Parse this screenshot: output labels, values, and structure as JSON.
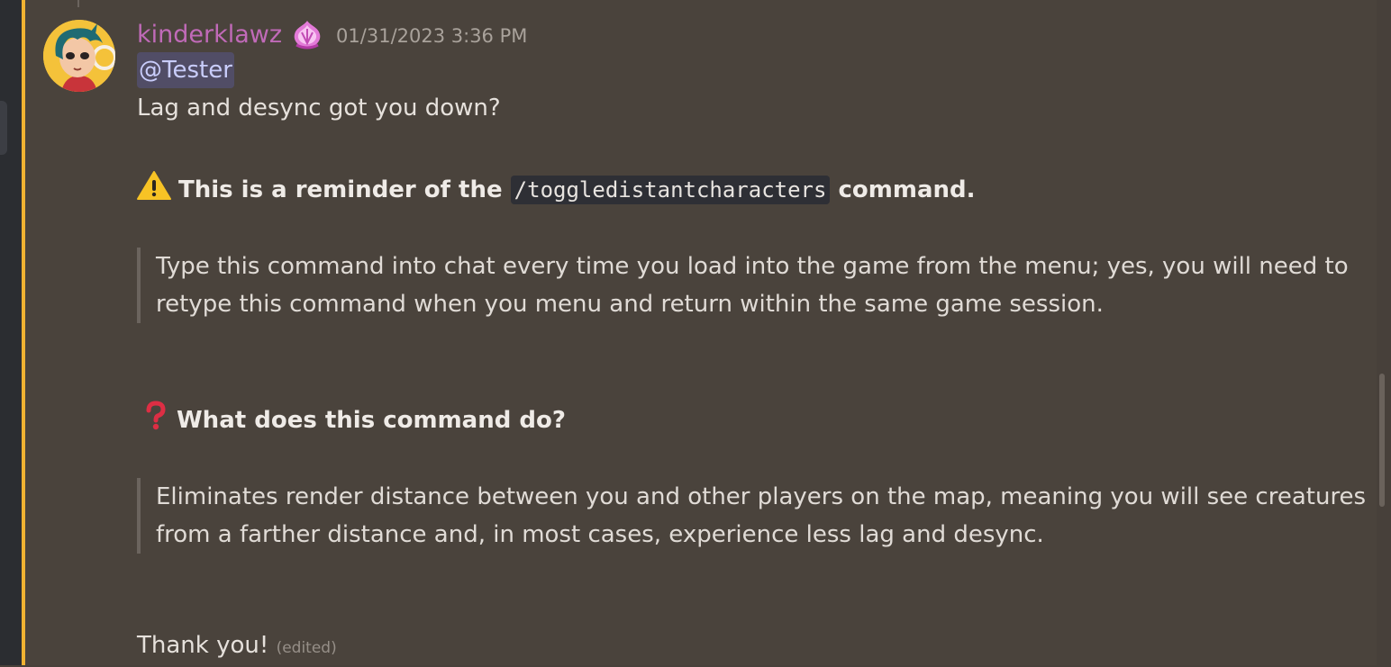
{
  "message": {
    "username": "kinderklawz",
    "timestamp": "01/31/2023 3:36 PM",
    "mention": "@Tester",
    "line1": "Lag and desync got you down?",
    "reminder_prefix": "This is a reminder of the",
    "command": "/toggledistantcharacters",
    "reminder_suffix": "command.",
    "quote1": "Type this command into chat every time you load into the game from the menu; yes, you will need to retype this command when you menu and return within the same game session.",
    "question": "What does this command do?",
    "quote2": "Eliminates render distance between you and other players on the map, meaning you will see creatures from a farther distance and, in most cases, experience less lag and desync.",
    "closing": "Thank you!",
    "edited": "(edited)"
  },
  "icons": {
    "warning": "warning-icon",
    "question": "question-mark-icon",
    "role": "role-badge-icon"
  },
  "colors": {
    "mention_highlight_bar": "#f0b232",
    "username": "#c06ab8",
    "mention_text": "#c9cdfb",
    "background": "#4a433c"
  }
}
